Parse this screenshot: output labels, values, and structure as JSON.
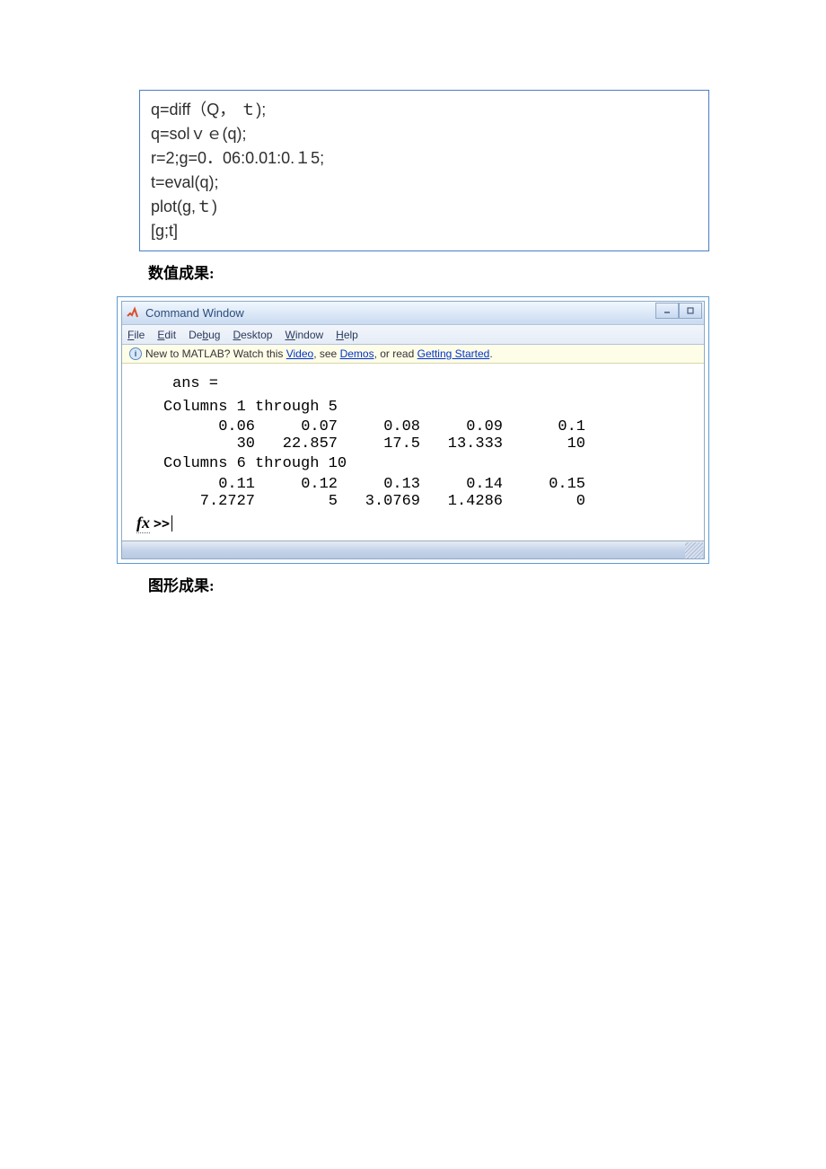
{
  "code": {
    "line1": "q=diff（Q， ｔ);",
    "line2": "q=solｖｅ(q);",
    "line3": "r=2;g=0．06:0.01:0.１5;",
    "line4": "t=eval(q);",
    "line5": "plot(g,ｔ)",
    "line6": "[g;t]"
  },
  "labels": {
    "numeric_result": "数值成果:",
    "graphic_result": "图形成果:"
  },
  "matlab": {
    "title": "Command Window",
    "menu": {
      "file": "File",
      "edit": "Edit",
      "debug": "Debug",
      "desktop": "Desktop",
      "window": "Window",
      "help": "Help"
    },
    "infobar": {
      "prefix": "New to MATLAB? Watch this ",
      "link1": "Video",
      "mid1": ", see ",
      "link2": "Demos",
      "mid2": ", or read ",
      "link3": "Getting Started",
      "suffix": "."
    },
    "output": {
      "ans_label": "ans =",
      "cols1_label": "Columns 1 through 5",
      "cols2_label": "Columns 6 through 10",
      "row1": [
        "0.06",
        "0.07",
        "0.08",
        "0.09",
        "0.1"
      ],
      "row2": [
        "30",
        "22.857",
        "17.5",
        "13.333",
        "10"
      ],
      "row3": [
        "0.11",
        "0.12",
        "0.13",
        "0.14",
        "0.15"
      ],
      "row4": [
        "7.2727",
        "5",
        "3.0769",
        "1.4286",
        "0"
      ],
      "prompt_fx": "fx",
      "prompt_gtgt": ">>"
    }
  }
}
